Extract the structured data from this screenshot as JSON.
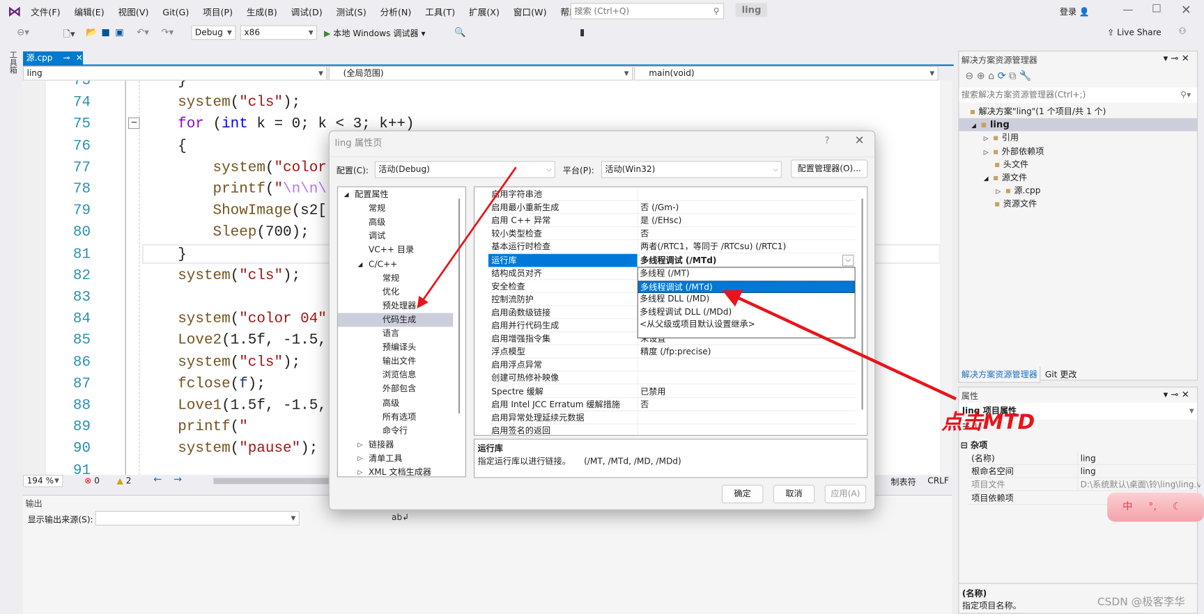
{
  "menu": [
    "文件(F)",
    "编辑(E)",
    "视图(V)",
    "Git(G)",
    "项目(P)",
    "生成(B)",
    "调试(D)",
    "测试(S)",
    "分析(N)",
    "工具(T)",
    "扩展(X)",
    "窗口(W)",
    "帮助(H)"
  ],
  "search": {
    "placeholder": "搜索 (Ctrl+Q)"
  },
  "solution_name": "ling",
  "login": "登录",
  "live_share": "Live Share",
  "toolbar": {
    "config": "Debug",
    "platform": "x86",
    "run": "本地 Windows 调试器"
  },
  "toolbox_label": "工具箱",
  "editor": {
    "tab": "源.cpp",
    "nav": {
      "project": "ling",
      "scope": "(全局范围)",
      "member": "main(void)"
    },
    "lines": [
      {
        "n": "73",
        "t": [
          [
            "    }",
            "pl"
          ]
        ]
      },
      {
        "n": "74",
        "t": [
          [
            "    ",
            "pl"
          ],
          [
            "system",
            "fn"
          ],
          [
            "(",
            "pl"
          ],
          [
            "\"cls\"",
            "st"
          ],
          [
            ");",
            "pl"
          ]
        ]
      },
      {
        "n": "75",
        "t": [
          [
            "    ",
            "pl"
          ],
          [
            "for",
            "ct"
          ],
          [
            " (",
            "pl"
          ],
          [
            "int",
            "kw"
          ],
          [
            " k = 0; k < 3; k++)",
            "pl"
          ]
        ]
      },
      {
        "n": "76",
        "t": [
          [
            "    {",
            "pl"
          ]
        ]
      },
      {
        "n": "77",
        "t": [
          [
            "        ",
            "pl"
          ],
          [
            "system",
            "fn"
          ],
          [
            "(",
            "pl"
          ],
          [
            "\"color",
            "st"
          ]
        ]
      },
      {
        "n": "78",
        "t": [
          [
            "        ",
            "pl"
          ],
          [
            "printf",
            "fn"
          ],
          [
            "(",
            "pl"
          ],
          [
            "\"",
            "st"
          ],
          [
            "\\n\\n\\",
            "es"
          ]
        ]
      },
      {
        "n": "79",
        "t": [
          [
            "        ",
            "pl"
          ],
          [
            "ShowImage",
            "fn"
          ],
          [
            "(s2[",
            "pl"
          ]
        ]
      },
      {
        "n": "80",
        "t": [
          [
            "        ",
            "pl"
          ],
          [
            "Sleep",
            "fn"
          ],
          [
            "(700);",
            "pl"
          ]
        ]
      },
      {
        "n": "81",
        "t": [
          [
            "    }",
            "pl"
          ]
        ]
      },
      {
        "n": "82",
        "t": [
          [
            "    ",
            "pl"
          ],
          [
            "system",
            "fn"
          ],
          [
            "(",
            "pl"
          ],
          [
            "\"cls\"",
            "st"
          ],
          [
            ");",
            "pl"
          ]
        ]
      },
      {
        "n": "83",
        "t": []
      },
      {
        "n": "84",
        "t": [
          [
            "    ",
            "pl"
          ],
          [
            "system",
            "fn"
          ],
          [
            "(",
            "pl"
          ],
          [
            "\"color 04\"",
            "st"
          ]
        ]
      },
      {
        "n": "85",
        "t": [
          [
            "    ",
            "pl"
          ],
          [
            "Love2",
            "fn"
          ],
          [
            "(1.5f, -1.5,",
            "pl"
          ]
        ]
      },
      {
        "n": "86",
        "t": [
          [
            "    ",
            "pl"
          ],
          [
            "system",
            "fn"
          ],
          [
            "(",
            "pl"
          ],
          [
            "\"cls\"",
            "st"
          ],
          [
            ");",
            "pl"
          ]
        ]
      },
      {
        "n": "87",
        "t": [
          [
            "    ",
            "pl"
          ],
          [
            "fclose",
            "fn"
          ],
          [
            "(",
            "pl"
          ],
          [
            "f",
            "va"
          ],
          [
            ");",
            "pl"
          ]
        ]
      },
      {
        "n": "88",
        "t": [
          [
            "    ",
            "pl"
          ],
          [
            "Love1",
            "fn"
          ],
          [
            "(1.5f, -1.5,",
            "pl"
          ]
        ]
      },
      {
        "n": "89",
        "t": [
          [
            "    ",
            "pl"
          ],
          [
            "printf",
            "fn"
          ],
          [
            "(",
            "pl"
          ],
          [
            "\"",
            "st"
          ]
        ]
      },
      {
        "n": "90",
        "t": [
          [
            "    ",
            "pl"
          ],
          [
            "system",
            "fn"
          ],
          [
            "(",
            "pl"
          ],
          [
            "\"pause\"",
            "st"
          ],
          [
            ");",
            "pl"
          ]
        ]
      },
      {
        "n": "91",
        "t": []
      }
    ],
    "status": {
      "zoom": "194 %",
      "errors": "0",
      "warnings": "2",
      "tabs": "制表符",
      "eol": "CRLF"
    }
  },
  "output": {
    "title": "输出",
    "source_label": "显示输出来源(S):"
  },
  "dialog": {
    "title": "ling 属性页",
    "help": "?",
    "config_label": "配置(C):",
    "config_value": "活动(Debug)",
    "platform_label": "平台(P):",
    "platform_value": "活动(Win32)",
    "config_manager": "配置管理器(O)...",
    "tree": [
      {
        "label": "配置属性",
        "lvl": 0,
        "exp": "◢"
      },
      {
        "label": "常规",
        "lvl": 1
      },
      {
        "label": "高级",
        "lvl": 1
      },
      {
        "label": "调试",
        "lvl": 1
      },
      {
        "label": "VC++ 目录",
        "lvl": 1
      },
      {
        "label": "C/C++",
        "lvl": 1,
        "exp": "◢"
      },
      {
        "label": "常规",
        "lvl": 2
      },
      {
        "label": "优化",
        "lvl": 2
      },
      {
        "label": "预处理器",
        "lvl": 2
      },
      {
        "label": "代码生成",
        "lvl": 2,
        "sel": true
      },
      {
        "label": "语言",
        "lvl": 2
      },
      {
        "label": "预编译头",
        "lvl": 2
      },
      {
        "label": "输出文件",
        "lvl": 2
      },
      {
        "label": "浏览信息",
        "lvl": 2
      },
      {
        "label": "外部包含",
        "lvl": 2
      },
      {
        "label": "高级",
        "lvl": 2
      },
      {
        "label": "所有选项",
        "lvl": 2
      },
      {
        "label": "命令行",
        "lvl": 2
      },
      {
        "label": "链接器",
        "lvl": 1,
        "exp": "▷"
      },
      {
        "label": "清单工具",
        "lvl": 1,
        "exp": "▷"
      },
      {
        "label": "XML 文档生成器",
        "lvl": 1,
        "exp": "▷"
      }
    ],
    "props": [
      [
        "启用字符串池",
        ""
      ],
      [
        "启用最小重新生成",
        "否 (/Gm-)"
      ],
      [
        "启用 C++ 异常",
        "是 (/EHsc)"
      ],
      [
        "较小类型检查",
        "否"
      ],
      [
        "基本运行时检查",
        "两者(/RTC1，等同于 /RTCsu) (/RTC1)"
      ],
      [
        "运行库",
        "多线程调试 (/MTd)"
      ],
      [
        "结构成员对齐",
        ""
      ],
      [
        "安全检查",
        ""
      ],
      [
        "控制流防护",
        ""
      ],
      [
        "启用函数级链接",
        ""
      ],
      [
        "启用并行代码生成",
        ""
      ],
      [
        "启用增强指令集",
        "未设置"
      ],
      [
        "浮点模型",
        "精度 (/fp:precise)"
      ],
      [
        "启用浮点异常",
        ""
      ],
      [
        "创建可热修补映像",
        ""
      ],
      [
        "Spectre 缓解",
        "已禁用"
      ],
      [
        "启用 Intel JCC Erratum 缓解措施",
        "否"
      ],
      [
        "启用异常处理延续元数据",
        ""
      ],
      [
        "启用签名的返回",
        ""
      ]
    ],
    "selected_prop": "运行库",
    "dropdown_options": [
      "多线程 (/MT)",
      "多线程调试 (/MTd)",
      "多线程 DLL (/MD)",
      "多线程调试 DLL (/MDd)",
      "<从父级或项目默认设置继承>"
    ],
    "dropdown_highlight": "多线程调试 (/MTd)",
    "desc_title": "运行库",
    "desc_text": "指定运行库以进行链接。     (/MT, /MTd, /MD, /MDd)",
    "ok": "确定",
    "cancel": "取消",
    "apply": "应用(A)"
  },
  "solution_explorer": {
    "title": "解决方案资源管理器",
    "search_placeholder": "搜索解决方案资源管理器(Ctrl+;)",
    "items": [
      {
        "label": "解决方案\"ling\"(1 个项目/共 1 个)",
        "lvl": 0
      },
      {
        "label": "ling",
        "lvl": 1,
        "exp": "◢",
        "bold": true
      },
      {
        "label": "引用",
        "lvl": 2,
        "exp": "▷"
      },
      {
        "label": "外部依赖项",
        "lvl": 2,
        "exp": "▷"
      },
      {
        "label": "头文件",
        "lvl": 2
      },
      {
        "label": "源文件",
        "lvl": 2,
        "exp": "◢"
      },
      {
        "label": "源.cpp",
        "lvl": 3,
        "exp": "▷"
      },
      {
        "label": "资源文件",
        "lvl": 2
      }
    ],
    "tabs": [
      "解决方案资源管理器",
      "Git 更改"
    ]
  },
  "properties": {
    "title": "属性",
    "object": "ling 项目属性",
    "category": "杂项",
    "rows": [
      [
        "(名称)",
        "ling"
      ],
      [
        "根命名空间",
        "ling"
      ],
      [
        "项目文件",
        "D:\\系统默认\\桌面\\铃\\ling\\ling.vcxproj"
      ],
      [
        "项目依赖项",
        ""
      ]
    ],
    "desc_title": "(名称)",
    "desc_text": "指定项目名称。"
  },
  "annotation": {
    "text": "点击MTD",
    "color": "#e8141a"
  },
  "watermark": "CSDN @极客李华",
  "ime_sticker": "中",
  "colors": {
    "accent": "#007acc",
    "selection": "#0078d7",
    "arrow": "#e8141a"
  }
}
